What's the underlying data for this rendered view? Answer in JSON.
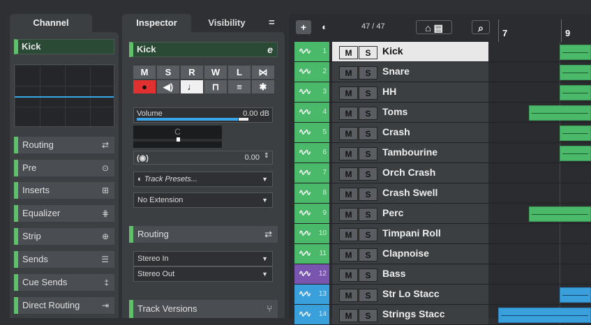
{
  "left_panel": {
    "tab_label": "Channel",
    "channel_name": "Kick",
    "sections": [
      {
        "label": "Routing",
        "icon": "routing-icon",
        "glyph": "⇄"
      },
      {
        "label": "Pre",
        "icon": "pre-icon",
        "glyph": "⊙"
      },
      {
        "label": "Inserts",
        "icon": "inserts-icon",
        "glyph": "⊞"
      },
      {
        "label": "Equalizer",
        "icon": "equalizer-icon",
        "glyph": "⋕"
      },
      {
        "label": "Strip",
        "icon": "strip-icon",
        "glyph": "⊕"
      },
      {
        "label": "Sends",
        "icon": "sends-icon",
        "glyph": "☰"
      },
      {
        "label": "Cue Sends",
        "icon": "cue-sends-icon",
        "glyph": "‡"
      },
      {
        "label": "Direct Routing",
        "icon": "direct-routing-icon",
        "glyph": "⇥"
      }
    ],
    "accent_color": "#5fbf6a"
  },
  "inspector": {
    "tabs": [
      "Inspector",
      "Visibility"
    ],
    "track_name": "Kick",
    "buttons_row1": [
      "M",
      "S",
      "R",
      "W",
      "L",
      "⋈"
    ],
    "buttons_row2_icons": [
      "record-icon",
      "monitor-icon",
      "note-icon",
      "lock-icon",
      "list-icon",
      "asterisk-icon"
    ],
    "buttons_row2_glyphs": [
      "●",
      "◀)",
      "♩",
      "⊓",
      "≡",
      "✱"
    ],
    "volume_label": "Volume",
    "volume_value": "0.00 dB",
    "pan_label": "C",
    "delay_value": "0.00",
    "track_presets_placeholder": "Track Presets...",
    "extension_value": "No Extension",
    "routing_label": "Routing",
    "input_routing": "Stereo In",
    "output_routing": "Stereo Out",
    "track_versions_label": "Track Versions"
  },
  "project": {
    "track_count": "47 / 47",
    "ruler_marks": [
      "7",
      "9"
    ],
    "tracks": [
      {
        "num": "1",
        "name": "Kick",
        "color": "#4aba6a",
        "selected": true
      },
      {
        "num": "2",
        "name": "Snare",
        "color": "#4aba6a"
      },
      {
        "num": "3",
        "name": "HH",
        "color": "#4aba6a"
      },
      {
        "num": "4",
        "name": "Toms",
        "color": "#4aba6a"
      },
      {
        "num": "5",
        "name": "Crash",
        "color": "#4aba6a"
      },
      {
        "num": "6",
        "name": "Tambourine",
        "color": "#4aba6a"
      },
      {
        "num": "7",
        "name": "Orch Crash",
        "color": "#4aba6a"
      },
      {
        "num": "8",
        "name": "Crash Swell",
        "color": "#4aba6a"
      },
      {
        "num": "9",
        "name": "Perc",
        "color": "#4aba6a"
      },
      {
        "num": "10",
        "name": "Timpani Roll",
        "color": "#4aba6a"
      },
      {
        "num": "11",
        "name": "Clapnoise",
        "color": "#4aba6a"
      },
      {
        "num": "12",
        "name": "Bass",
        "color": "#7a55b0"
      },
      {
        "num": "13",
        "name": "Str Lo Stacc",
        "color": "#39a0dc"
      },
      {
        "num": "14",
        "name": "Strings Stacc",
        "color": "#39a0dc"
      }
    ],
    "mute_label": "M",
    "solo_label": "S"
  }
}
